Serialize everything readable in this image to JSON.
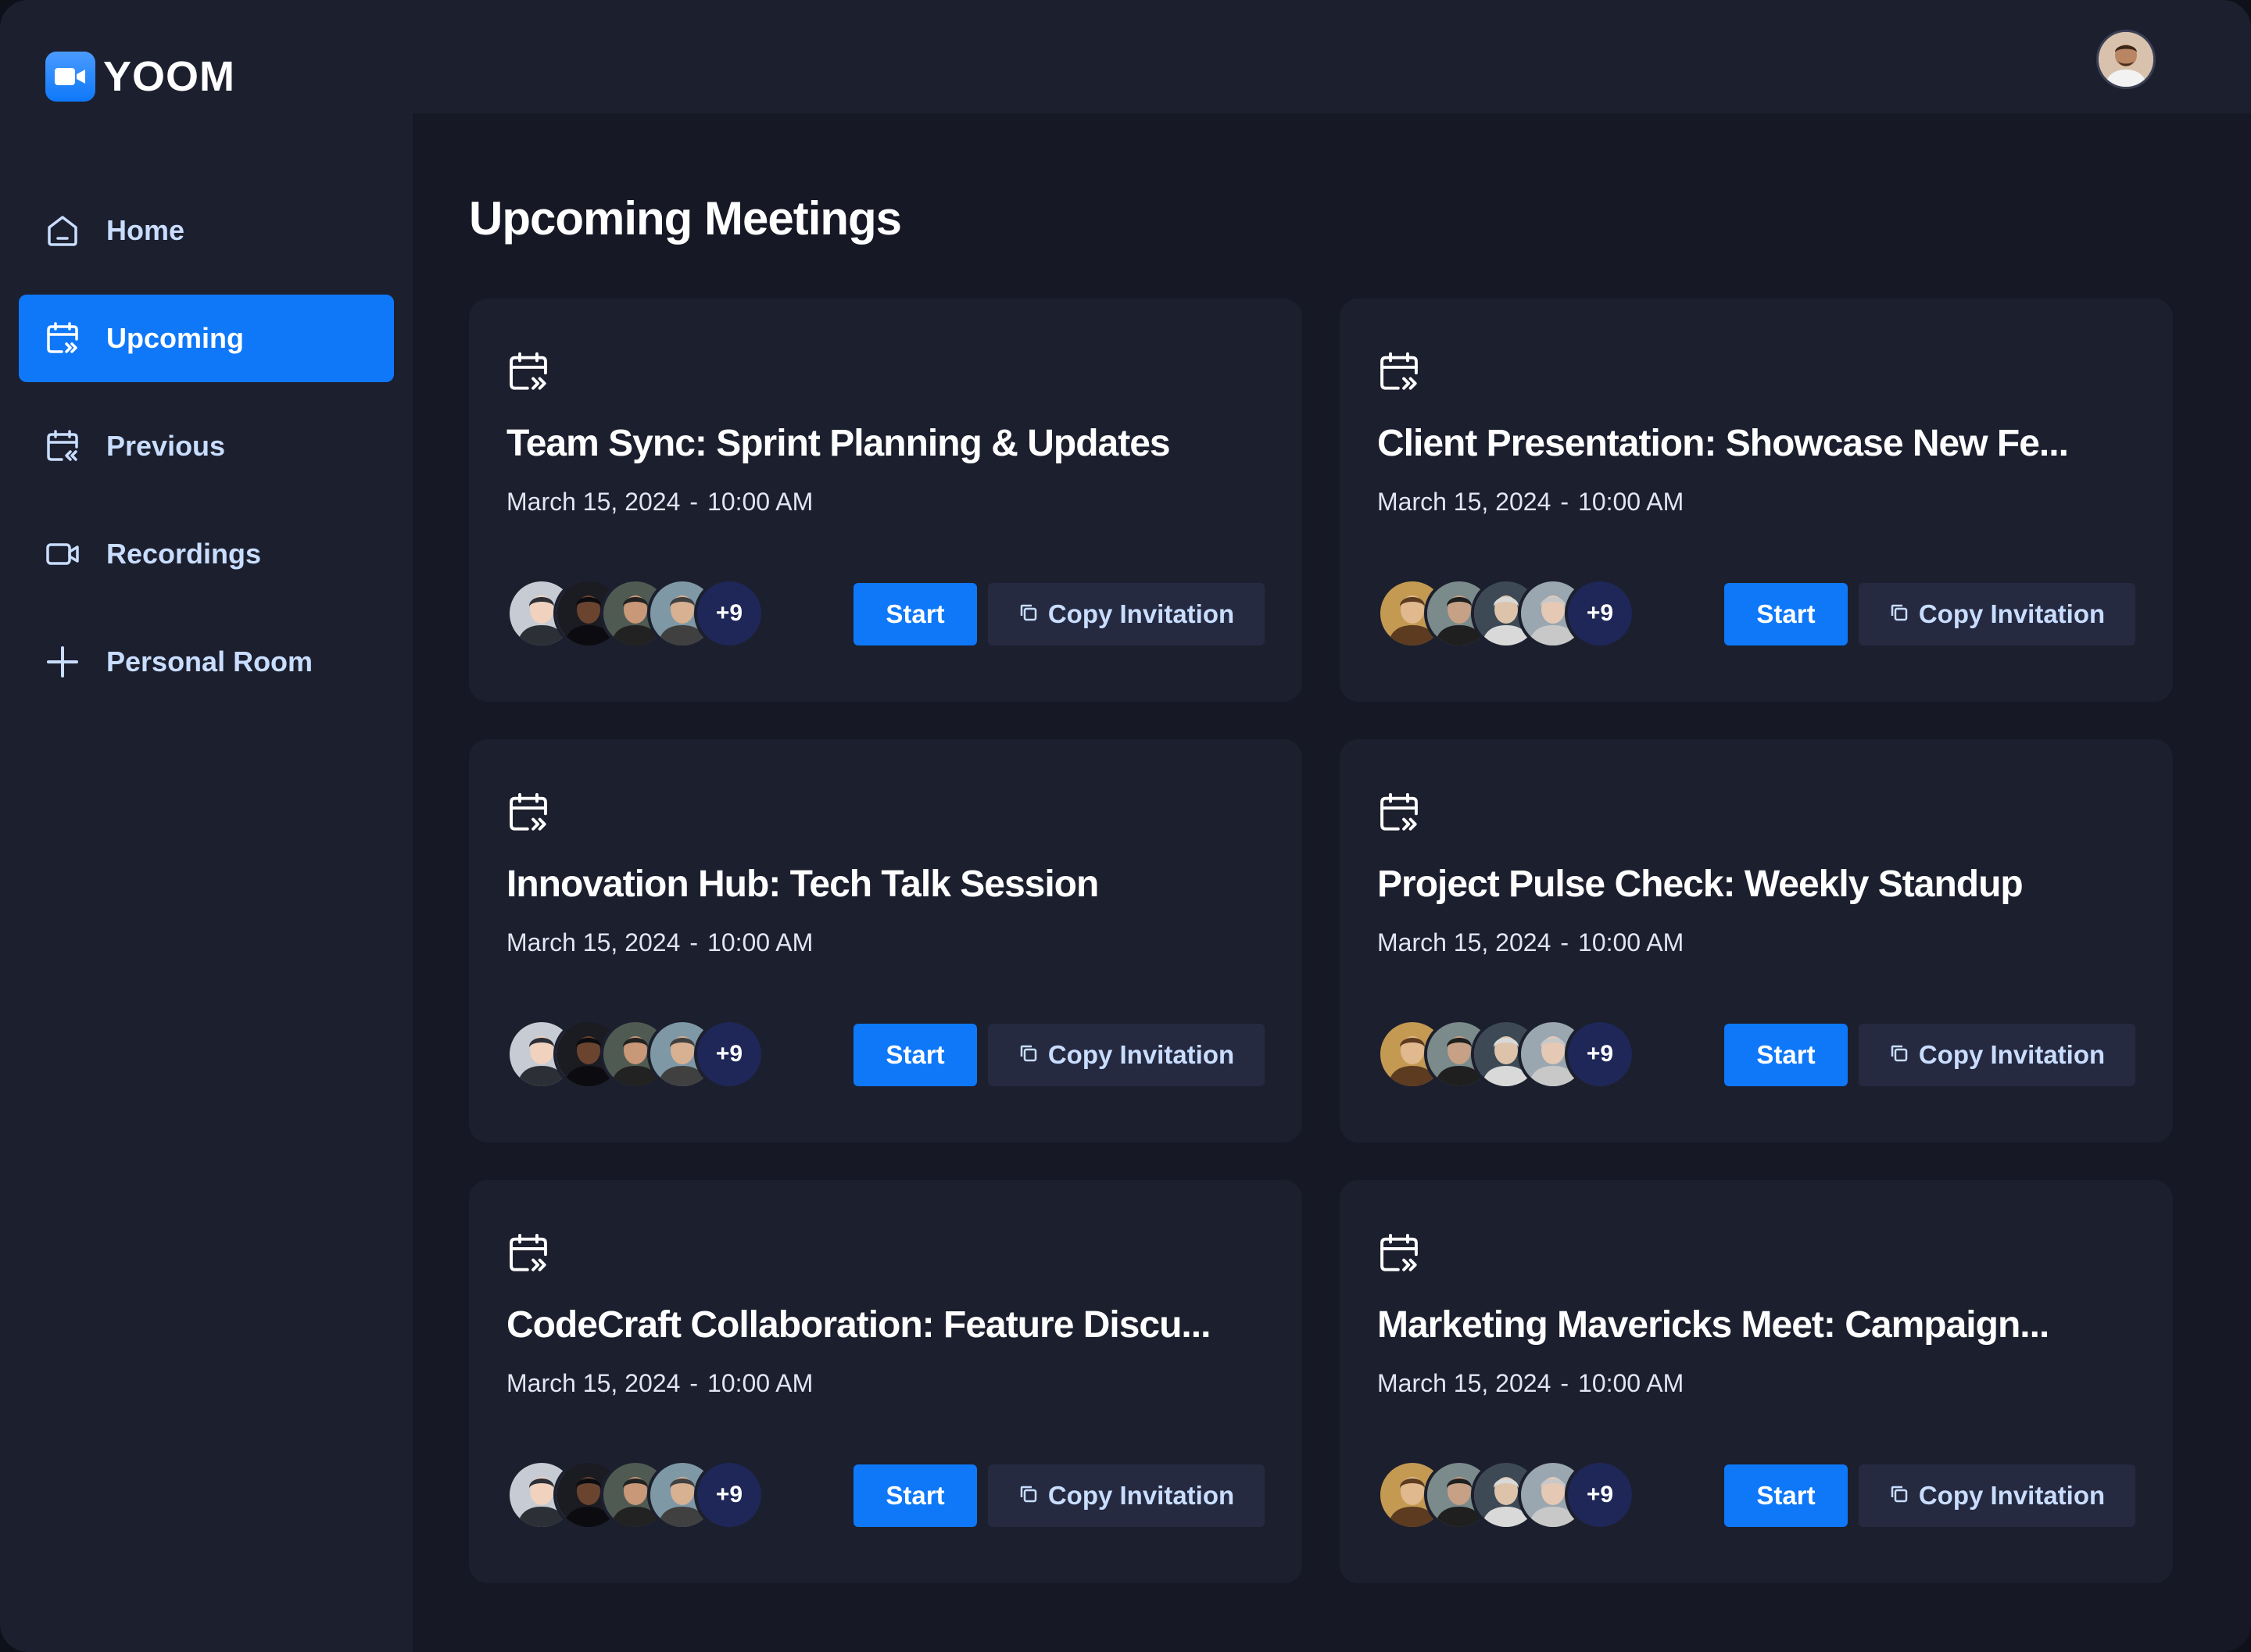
{
  "app": {
    "name": "YOOM",
    "logo_icon": "video-camera-icon",
    "profile_icon": "user-avatar"
  },
  "sidebar": {
    "items": [
      {
        "label": "Home",
        "icon": "home-icon",
        "active": false
      },
      {
        "label": "Upcoming",
        "icon": "calendar-forward-icon",
        "active": true
      },
      {
        "label": "Previous",
        "icon": "calendar-back-icon",
        "active": false
      },
      {
        "label": "Recordings",
        "icon": "video-icon",
        "active": false
      },
      {
        "label": "Personal Room",
        "icon": "plus-icon",
        "active": false
      }
    ]
  },
  "main": {
    "title": "Upcoming Meetings",
    "meetings": [
      {
        "title": "Team Sync: Sprint Planning & Updates",
        "date": "March 15, 2024",
        "time": "10:00 AM",
        "extra_attendees": "+9",
        "start_label": "Start",
        "copy_label": "Copy Invitation"
      },
      {
        "title": "Client Presentation: Showcase New Fe...",
        "date": "March 15, 2024",
        "time": "10:00 AM",
        "extra_attendees": "+9",
        "start_label": "Start",
        "copy_label": "Copy Invitation"
      },
      {
        "title": "Innovation Hub: Tech Talk Session",
        "date": "March 15, 2024",
        "time": "10:00 AM",
        "extra_attendees": "+9",
        "start_label": "Start",
        "copy_label": "Copy Invitation"
      },
      {
        "title": "Project Pulse Check: Weekly Standup",
        "date": "March 15, 2024",
        "time": "10:00 AM",
        "extra_attendees": "+9",
        "start_label": "Start",
        "copy_label": "Copy Invitation"
      },
      {
        "title": "CodeCraft Collaboration: Feature Discu...",
        "date": "March 15, 2024",
        "time": "10:00 AM",
        "extra_attendees": "+9",
        "start_label": "Start",
        "copy_label": "Copy Invitation"
      },
      {
        "title": "Marketing Mavericks Meet: Campaign...",
        "date": "March 15, 2024",
        "time": "10:00 AM",
        "extra_attendees": "+9",
        "start_label": "Start",
        "copy_label": "Copy Invitation"
      }
    ],
    "date_separator": "-"
  },
  "colors": {
    "accent": "#0e78f9",
    "app_bg": "#1c1f2e",
    "main_bg": "#161925",
    "card_bg": "#1c1f2e",
    "copy_btn_bg": "#252a41",
    "nav_text": "#c9ddff",
    "more_badge_bg": "#1e2757"
  }
}
